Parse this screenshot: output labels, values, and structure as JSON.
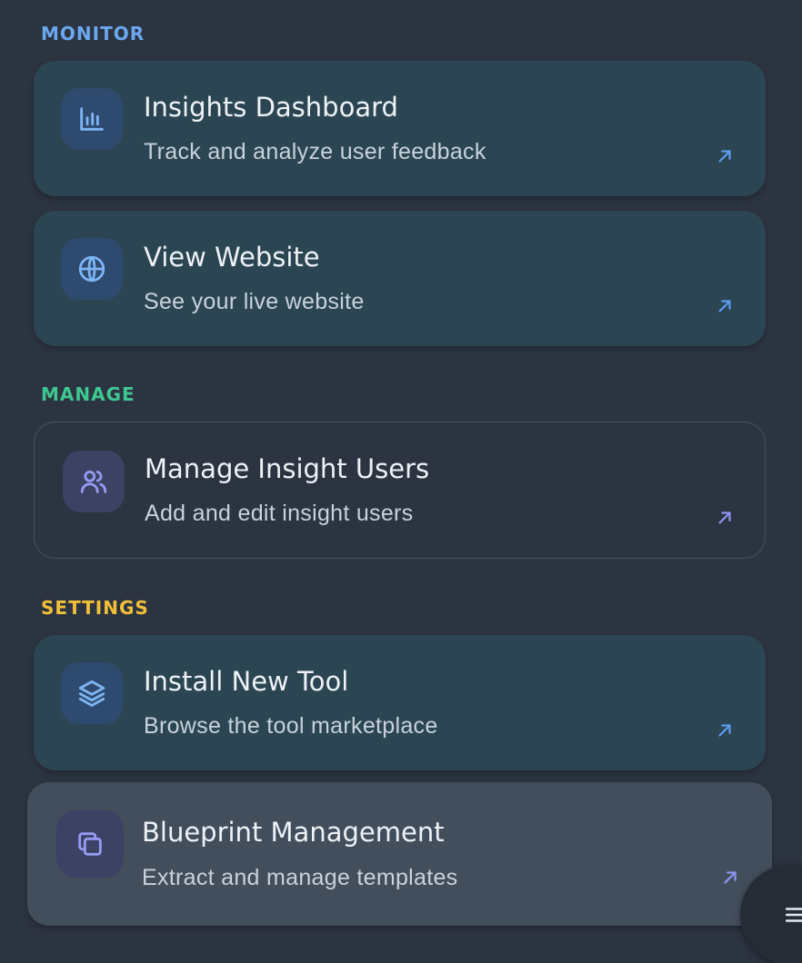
{
  "colors": {
    "background": "#2c3441",
    "monitor": "#6aa8ef",
    "manage": "#3ec891",
    "settings": "#f2c037",
    "card_teal": "#2b4652",
    "card_hover": "#434e5d",
    "arrow_blue": "#5b9cf0",
    "arrow_purple": "#8f95f2"
  },
  "sections": {
    "monitor": "MONITOR",
    "manage": "MANAGE",
    "settings": "SETTINGS"
  },
  "cards": [
    {
      "title": "Insights Dashboard",
      "description": "Track and analyze user feedback",
      "icon": "bar-chart-icon",
      "arrow": "external-arrow-icon"
    },
    {
      "title": "View Website",
      "description": "See your live website",
      "icon": "globe-icon",
      "arrow": "external-arrow-icon"
    },
    {
      "title": "Manage Insight Users",
      "description": "Add and edit insight users",
      "icon": "users-icon",
      "arrow": "external-arrow-icon"
    },
    {
      "title": "Install New Tool",
      "description": "Browse the tool marketplace",
      "icon": "layers-icon",
      "arrow": "external-arrow-icon"
    },
    {
      "title": "Blueprint Management",
      "description": "Extract and manage templates",
      "icon": "copy-icon",
      "arrow": "external-arrow-icon"
    }
  ],
  "fab": {
    "icon": "menu-icon"
  }
}
